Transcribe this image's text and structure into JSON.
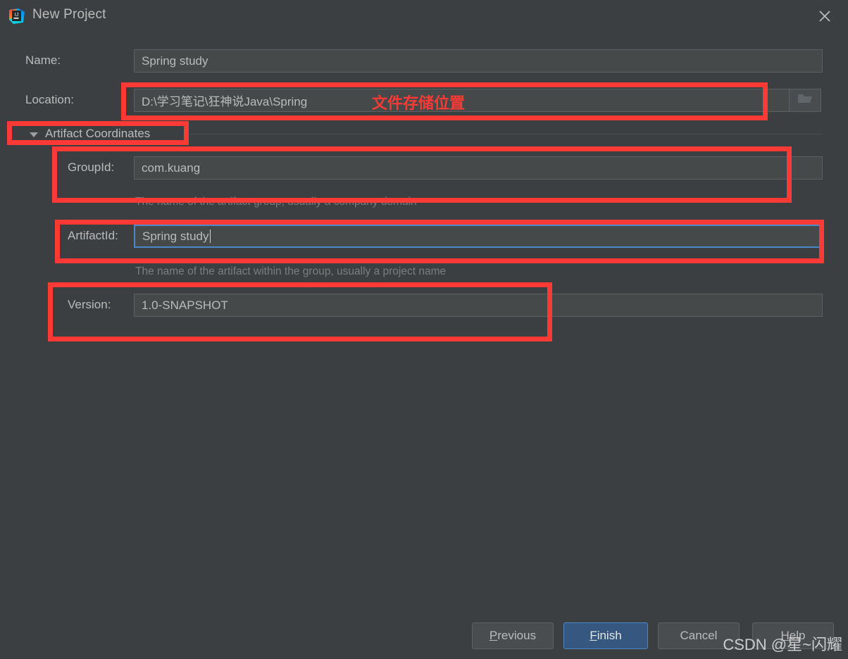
{
  "window": {
    "title": "New Project",
    "logo_icon": "intellij-idea-logo",
    "close_icon": "close-icon"
  },
  "form": {
    "name": {
      "label": "Name:",
      "value": "Spring study"
    },
    "location": {
      "label": "Location:",
      "value": "D:\\学习笔记\\狂神说Java\\Spring",
      "browse_icon": "folder-icon"
    },
    "section": {
      "title": "Artifact Coordinates",
      "expanded_icon": "chevron-down-icon"
    },
    "group_id": {
      "label": "GroupId:",
      "value": "com.kuang",
      "hint": "The name of the artifact group, usually a company domain"
    },
    "artifact_id": {
      "label": "ArtifactId:",
      "value": "Spring study",
      "hint": "The name of the artifact within the group, usually a project name",
      "focused": true
    },
    "version": {
      "label": "Version:",
      "value": "1.0-SNAPSHOT"
    }
  },
  "buttons": {
    "previous": {
      "prefix": "P",
      "rest": "revious"
    },
    "finish": {
      "prefix": "F",
      "rest": "inish"
    },
    "cancel": {
      "label": "Cancel"
    },
    "help": {
      "prefix": "H",
      "rest": "elp"
    }
  },
  "annotations": {
    "location_note": "文件存储位置"
  },
  "watermark": {
    "text": "CSDN @星~闪耀"
  },
  "colors": {
    "dialog_bg": "#3c3f41",
    "field_bg": "#45494a",
    "accent_blue": "#365880",
    "focus_blue": "#4a88c7",
    "annotation_red": "#fc3a35",
    "text": "#bbbbbb",
    "hint_text": "#7a7e80"
  }
}
